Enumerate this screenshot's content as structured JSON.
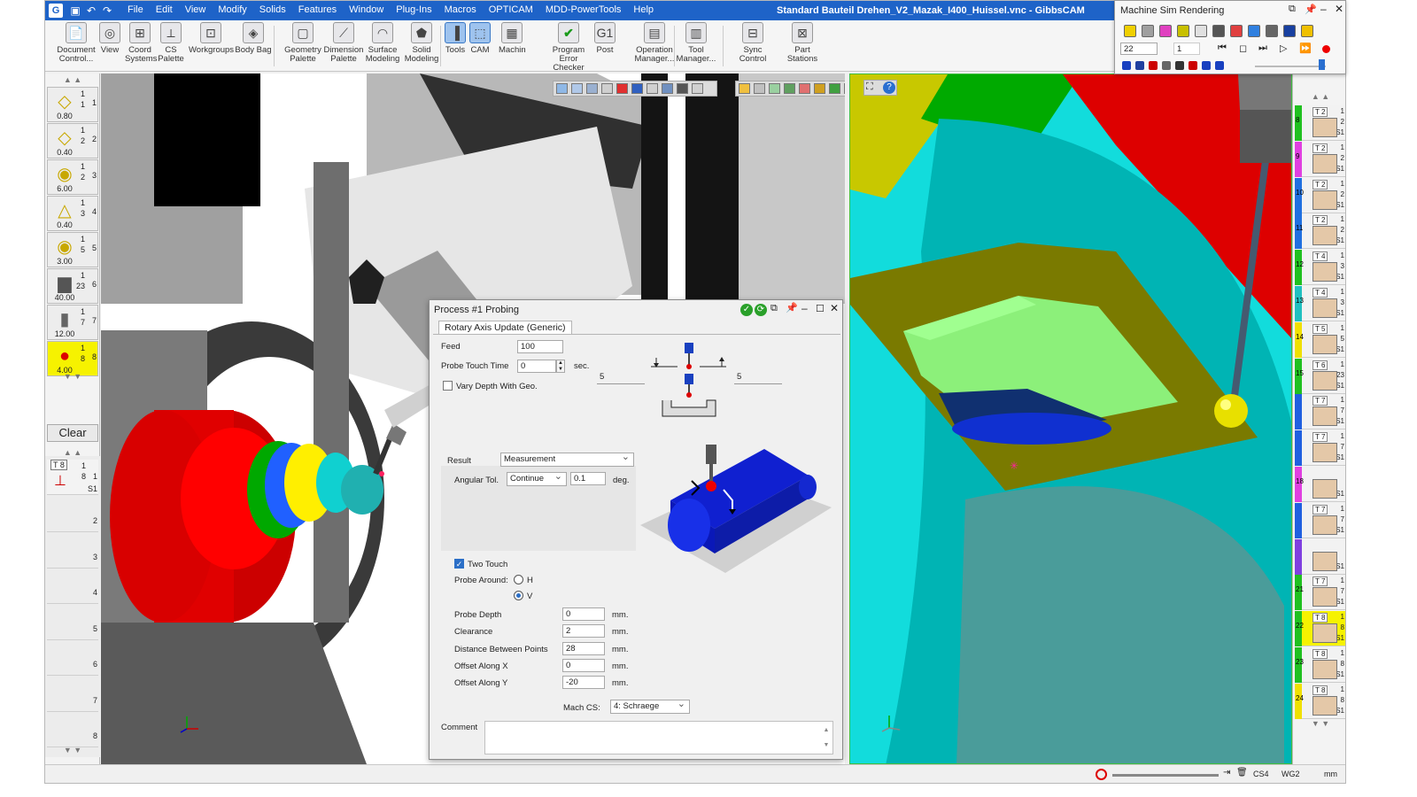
{
  "window": {
    "title": "Standard Bauteil Drehen_V2_Mazak_I400_Huissel.vnc - GibbsCAM",
    "app_icon": "G"
  },
  "menu": [
    "File",
    "Edit",
    "View",
    "Modify",
    "Solids",
    "Features",
    "Window",
    "Plug-Ins",
    "Macros",
    "OPTICAM",
    "MDD-PowerTools",
    "Help"
  ],
  "ribbon": [
    {
      "label": "Document Control...",
      "icon": "document-icon"
    },
    {
      "label": "View",
      "icon": "view-icon"
    },
    {
      "label": "Coord Systems",
      "icon": "coord-icon"
    },
    {
      "label": "CS Palette",
      "icon": "cs-palette-icon"
    },
    {
      "label": "Workgroups",
      "icon": "workgroups-icon"
    },
    {
      "label": "Body Bag",
      "icon": "body-bag-icon"
    },
    {
      "label": "Geometry Palette",
      "icon": "geometry-icon"
    },
    {
      "label": "Dimension Palette",
      "icon": "dimension-icon"
    },
    {
      "label": "Surface Modeling",
      "icon": "surface-icon"
    },
    {
      "label": "Solid Modeling",
      "icon": "solid-icon"
    },
    {
      "label": "Tools",
      "icon": "tools-icon"
    },
    {
      "label": "CAM",
      "icon": "cam-icon"
    },
    {
      "label": "Machin",
      "icon": "machine-icon"
    },
    {
      "label": "Program Error Checker",
      "icon": "checker-icon"
    },
    {
      "label": "Post",
      "icon": "post-icon"
    },
    {
      "label": "Operation Manager...",
      "icon": "operation-icon"
    },
    {
      "label": "Tool Manager...",
      "icon": "tool-manager-icon"
    },
    {
      "label": "Sync Control",
      "icon": "sync-icon"
    },
    {
      "label": "Part Stations",
      "icon": "part-stations-icon"
    }
  ],
  "tools": [
    {
      "value": "0.80",
      "n1": "1",
      "n2": "1",
      "n3": "1",
      "glyph": "◇"
    },
    {
      "value": "0.40",
      "n1": "1",
      "n2": "2",
      "n3": "2",
      "glyph": "◇"
    },
    {
      "value": "6.00",
      "n1": "1",
      "n2": "3",
      "n3": "2",
      "glyph": "◉"
    },
    {
      "value": "0.40",
      "n1": "1",
      "n2": "4",
      "n3": "3",
      "glyph": "△"
    },
    {
      "value": "3.00",
      "n1": "1",
      "n2": "5",
      "n3": "5",
      "glyph": "◉"
    },
    {
      "value": "40.00",
      "n1": "1",
      "n2": "6",
      "n3": "23",
      "glyph": "▆"
    },
    {
      "value": "12.00",
      "n1": "1",
      "n2": "7",
      "n3": "7",
      "glyph": "▮"
    },
    {
      "value": "4.00",
      "n1": "1",
      "n2": "8",
      "n3": "8",
      "glyph": "●"
    }
  ],
  "clear_label": "Clear",
  "process_slot": {
    "tag": "T 8",
    "n1": "1",
    "n2": "8",
    "n3": "1",
    "s": "S1"
  },
  "slot_numbers": [
    "2",
    "3",
    "4",
    "5",
    "6",
    "7",
    "8"
  ],
  "dialog": {
    "title": "Process #1 Probing",
    "tab": "Rotary Axis Update (Generic)",
    "feed_label": "Feed",
    "feed": "100",
    "probe_time_label": "Probe Touch Time",
    "probe_time": "0",
    "sec": "sec.",
    "vary_depth_label": "Vary Depth With Geo.",
    "left_val": "5",
    "right_val": "5",
    "result_label": "Result",
    "result": "Measurement",
    "angular_label": "Angular Tol.",
    "angular_mode": "Continue",
    "angular_val": "0.1",
    "deg": "deg.",
    "two_touch_label": "Two Touch",
    "probe_around_label": "Probe Around:",
    "opt_h": "H",
    "opt_v": "V",
    "fields": [
      {
        "label": "Probe Depth",
        "value": "0",
        "unit": "mm."
      },
      {
        "label": "Clearance",
        "value": "2",
        "unit": "mm."
      },
      {
        "label": "Distance Between Points",
        "value": "28",
        "unit": "mm."
      },
      {
        "label": "Offset Along X",
        "value": "0",
        "unit": "mm."
      },
      {
        "label": "Offset Along Y",
        "value": "-20",
        "unit": "mm."
      }
    ],
    "mach_cs_label": "Mach CS:",
    "mach_cs": "4: Schraege",
    "comment_label": "Comment"
  },
  "sim": {
    "title": "Machine Sim Rendering",
    "speed": "22",
    "step": "1"
  },
  "right_items": [
    {
      "tag": "T 2",
      "a": "1",
      "b": "2",
      "c": "S1",
      "color": "#20c020",
      "num": "8"
    },
    {
      "tag": "T 2",
      "a": "1",
      "b": "2",
      "c": "S1",
      "color": "#e040e0",
      "num": "9"
    },
    {
      "tag": "T 2",
      "a": "1",
      "b": "2",
      "c": "S1",
      "color": "#2070e0",
      "num": "10"
    },
    {
      "tag": "T 2",
      "a": "1",
      "b": "2",
      "c": "S1",
      "color": "#2070e0",
      "num": "11"
    },
    {
      "tag": "T 4",
      "a": "1",
      "b": "3",
      "c": "S1",
      "color": "#20c020",
      "num": "12"
    },
    {
      "tag": "T 4",
      "a": "1",
      "b": "3",
      "c": "S1",
      "color": "#20c0c0",
      "num": "13"
    },
    {
      "tag": "T 5",
      "a": "1",
      "b": "5",
      "c": "S1",
      "color": "#f0e000",
      "num": "14"
    },
    {
      "tag": "T 6",
      "a": "1",
      "b": "23",
      "c": "S1",
      "color": "#20c020",
      "num": "15"
    },
    {
      "tag": "T 7",
      "a": "1",
      "b": "7",
      "c": "S1",
      "color": "#2060e0",
      "num": ""
    },
    {
      "tag": "T 7",
      "a": "1",
      "b": "7",
      "c": "S1",
      "color": "#2060e0",
      "num": ""
    },
    {
      "tag": "",
      "a": "",
      "b": "",
      "c": "S1",
      "color": "#e040e0",
      "num": "18"
    },
    {
      "tag": "T 7",
      "a": "1",
      "b": "7",
      "c": "S1",
      "color": "#2060e0",
      "num": ""
    },
    {
      "tag": "",
      "a": "",
      "b": "",
      "c": "S1",
      "color": "#8040e0",
      "num": ""
    },
    {
      "tag": "T 7",
      "a": "1",
      "b": "7",
      "c": "S1",
      "color": "#20c020",
      "num": "21"
    },
    {
      "tag": "T 8",
      "a": "1",
      "b": "8",
      "c": "S1",
      "color": "#20c020",
      "num": "22",
      "sel": true
    },
    {
      "tag": "T 8",
      "a": "1",
      "b": "8",
      "c": "S1",
      "color": "#20c020",
      "num": "23"
    },
    {
      "tag": "T 8",
      "a": "1",
      "b": "8",
      "c": "S1",
      "color": "#f0e000",
      "num": "24"
    }
  ],
  "status": {
    "cs": "CS4",
    "wg": "WG2",
    "unit": "mm"
  }
}
